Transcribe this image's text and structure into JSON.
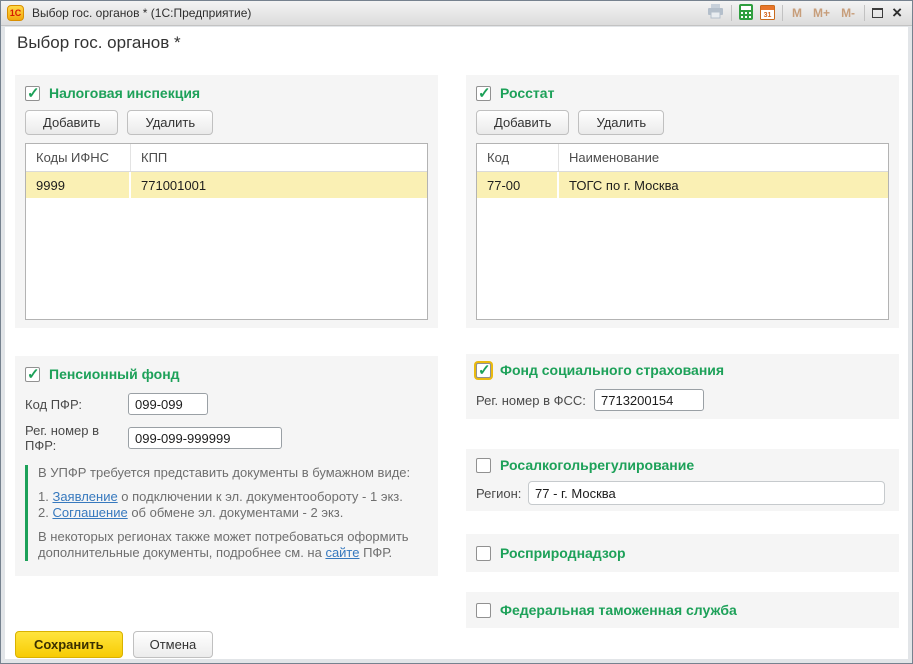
{
  "window": {
    "title": "Выбор гос. органов *  (1С:Предприятие)",
    "logo_text": "1С",
    "memory_buttons": {
      "m": "M",
      "m_plus": "M+",
      "m_minus": "M-"
    }
  },
  "page": {
    "title": "Выбор гос. органов *"
  },
  "actions": {
    "add": "Добавить",
    "delete": "Удалить"
  },
  "footer": {
    "save": "Сохранить",
    "cancel": "Отмена"
  },
  "colors": {
    "accent_green": "#1da159",
    "selected_row": "#faf0b4",
    "save_button": "#f9d716",
    "link_blue": "#3779be",
    "focus_ring": "#eaba10"
  },
  "sections": {
    "tax": {
      "title": "Налоговая инспекция",
      "checked": true,
      "table": {
        "headers": [
          "Коды ИФНС",
          "КПП"
        ],
        "rows": [
          [
            "9999",
            "771001001"
          ]
        ]
      }
    },
    "rosstat": {
      "title": "Росстат",
      "checked": true,
      "table": {
        "headers": [
          "Код",
          "Наименование"
        ],
        "rows": [
          [
            "77-00",
            "ТОГС по г. Москва"
          ]
        ]
      }
    },
    "pension": {
      "title": "Пенсионный фонд",
      "checked": true,
      "fields": [
        {
          "label": "Код ПФР:",
          "value": "099-099"
        },
        {
          "label": "Рег. номер в ПФР:",
          "value": "099-099-999999"
        }
      ],
      "note": {
        "line1": "В УПФР требуется представить документы в бумажном виде:",
        "item1_prefix": "1. ",
        "item1_link": "Заявление",
        "item1_rest": " о подключении к эл. документообороту - 1 экз.",
        "item2_prefix": "2. ",
        "item2_link": "Соглашение",
        "item2_rest": " об обмене эл. документами  - 2 экз.",
        "p2_part1": "В некоторых регионах также может потребоваться оформить дополнительные документы, подробнее см. на ",
        "p2_link": "сайте",
        "p2_part2": " ПФР."
      }
    },
    "fss": {
      "title": "Фонд социального страхования",
      "checked": true,
      "field": {
        "label": "Рег. номер в ФСС:",
        "value": "7713200154"
      }
    },
    "alco": {
      "title": "Росалкогольрегулирование",
      "checked": false,
      "field": {
        "label": "Регион:",
        "value": "77 - г. Москва"
      }
    },
    "nature": {
      "title": "Росприроднадзор",
      "checked": false
    },
    "customs": {
      "title": "Федеральная таможенная служба",
      "checked": false
    }
  }
}
